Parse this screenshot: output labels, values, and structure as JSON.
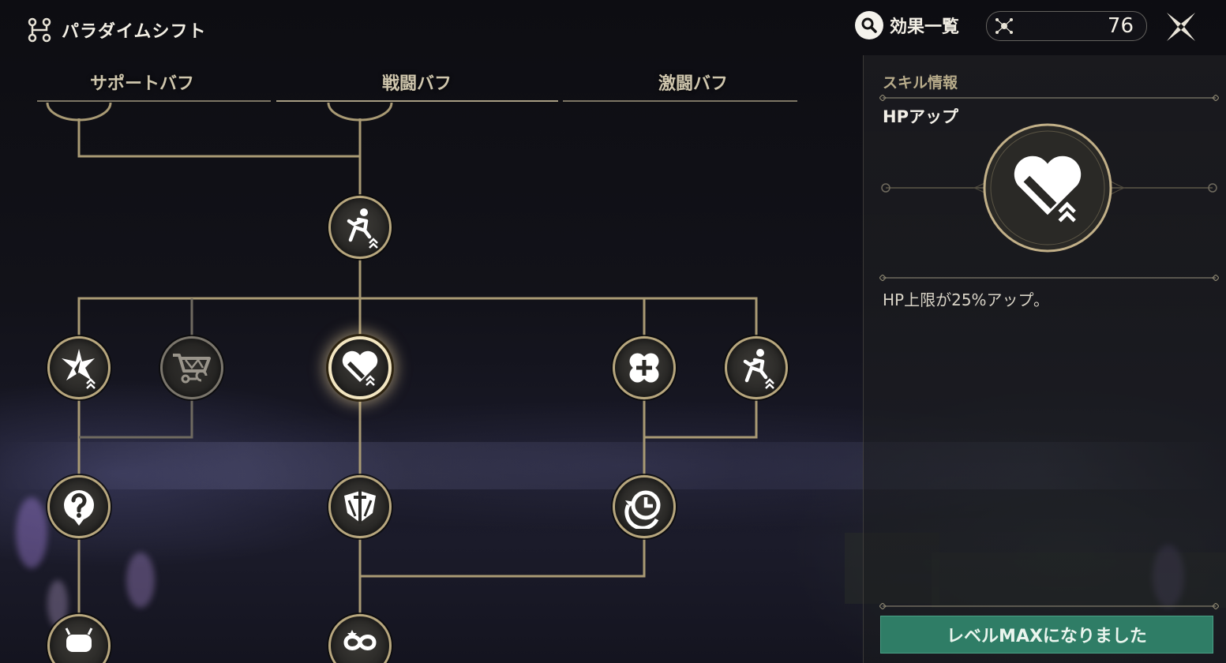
{
  "header": {
    "title": "パラダイムシフト",
    "search_label": "効果一覧",
    "points": "76"
  },
  "tabs": [
    {
      "label": "サポートバフ"
    },
    {
      "label": "戦闘バフ"
    },
    {
      "label": "激闘バフ"
    }
  ],
  "panel": {
    "section_title": "スキル情報",
    "skill_name": "HPアップ",
    "skill_description": "HP上限が25%アップ。",
    "max_button_label": "レベルMAXになりました"
  },
  "nodes": [
    {
      "id": "speed-up-top",
      "icon": "running-up-icon"
    },
    {
      "id": "support-star",
      "icon": "star-burst-up-icon"
    },
    {
      "id": "shop-cart",
      "icon": "shopping-cart-refresh-icon",
      "locked": true
    },
    {
      "id": "hp-up",
      "icon": "heart-up-icon",
      "selected": true
    },
    {
      "id": "bandage",
      "icon": "bandage-plus-icon"
    },
    {
      "id": "speed-up-right",
      "icon": "running-up-icon"
    },
    {
      "id": "unknown",
      "icon": "question-icon"
    },
    {
      "id": "sword-shield",
      "icon": "sword-shield-icon"
    },
    {
      "id": "cooldown",
      "icon": "clock-cycle-icon"
    },
    {
      "id": "robot",
      "icon": "robot-icon"
    },
    {
      "id": "infinity-bottom",
      "icon": "infinity-icon"
    }
  ],
  "colors": {
    "accent": "#b8a77e",
    "connector": "#a99a74",
    "max_button": "#2f7d66"
  }
}
